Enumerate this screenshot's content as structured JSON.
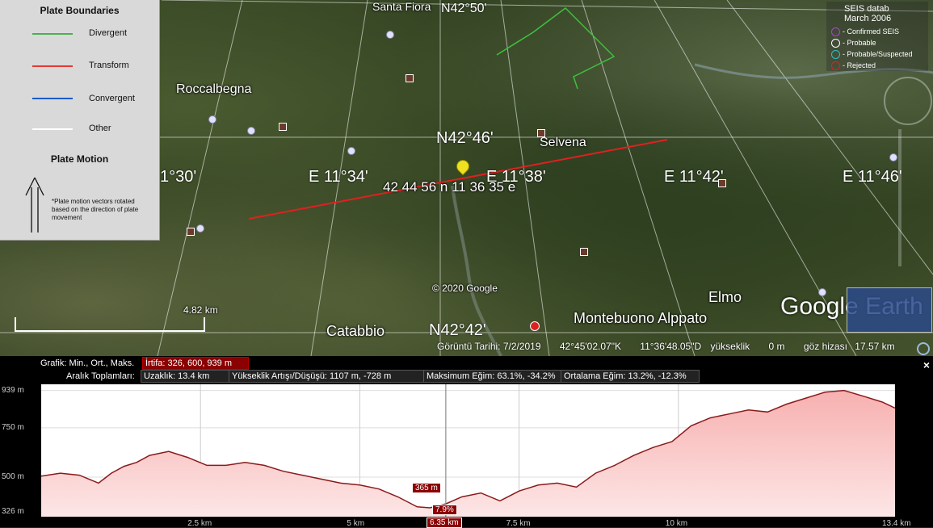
{
  "legend": {
    "title": "Plate Boundaries",
    "items": [
      {
        "label": "Divergent",
        "color": "#4caf50"
      },
      {
        "label": "Transform",
        "color": "#e53935"
      },
      {
        "label": "Convergent",
        "color": "#1e5ac8"
      },
      {
        "label": "Other",
        "color": "#ffffff"
      }
    ],
    "motion_title": "Plate Motion",
    "motion_note": "*Plate motion vectors rotated based on the direction of plate movement"
  },
  "seis": {
    "title": "SEIS datab",
    "subtitle": "March 2006",
    "items": [
      {
        "label": "- Confirmed SEIS",
        "color": "#b040d0"
      },
      {
        "label": "- Probable",
        "color": "#ffffff"
      },
      {
        "label": "- Probable/Suspected",
        "color": "#30c0c0"
      },
      {
        "label": "- Rejected",
        "color": "#e02020"
      }
    ]
  },
  "map": {
    "coords": {
      "n4250": "N42°50'",
      "n4246": "N42°46'",
      "n4242": "N42°42'",
      "e1130": "1°30'",
      "e1134": "E 11°34'",
      "e1138": "E 11°38'",
      "e1142": "E 11°42'",
      "e1146": "E 11°46'"
    },
    "places": {
      "santa_fiora": "Santa Fiora",
      "roccalbegna": "Roccalbegna",
      "selvena": "Selvena",
      "elmo": "Elmo",
      "catabbio": "Catabbio",
      "montebuono": "Montebuono Alppato"
    },
    "pin_label": "42 44 56 n 11 36 35 e",
    "copyright": "© 2020 Google",
    "brand": "Google Earth",
    "scale": "4.82 km",
    "status": {
      "date": "Görüntü Tarihi: 7/2/2019",
      "lat": "42°45'02.07\"K",
      "lon": "11°36'48.05\"D",
      "elev_label": "yükseklik",
      "elev": "0 m",
      "eye_label": "göz hizası",
      "eye": "17.57 km"
    }
  },
  "profile": {
    "row1_label": "Grafik: Min., Ort., Maks.",
    "row1_value": "İrtifa: 326, 600, 939 m",
    "row2_label": "Aralık Toplamları:",
    "distance": "Uzaklık: 13.4 km",
    "gain": "Yükseklik Artışı/Düşüşü: 1107 m, -728 m",
    "max_slope": "Maksimum Eğim: 63.1%, -34.2%",
    "avg_slope": "Ortalama Eğim: 13.2%, -12.3%",
    "cursor_elev": "365 m",
    "cursor_slope": "7.9%",
    "cursor_x": "6.35 km",
    "close": "×"
  },
  "chart_data": {
    "type": "area",
    "title": "",
    "xlabel": "",
    "ylabel": "",
    "ylim": [
      300,
      970
    ],
    "xlim": [
      0,
      13.4
    ],
    "yticks": [
      "326 m",
      "500 m",
      "750 m",
      "939 m"
    ],
    "xticks": [
      "2.5 km",
      "5 km",
      "7.5 km",
      "10 km",
      "13.4 km"
    ],
    "x": [
      0,
      0.3,
      0.6,
      0.9,
      1.1,
      1.3,
      1.5,
      1.7,
      2.0,
      2.3,
      2.6,
      2.9,
      3.2,
      3.5,
      3.8,
      4.1,
      4.4,
      4.7,
      5.0,
      5.3,
      5.6,
      5.9,
      6.1,
      6.35,
      6.6,
      6.9,
      7.2,
      7.5,
      7.8,
      8.1,
      8.4,
      8.7,
      9.0,
      9.3,
      9.6,
      9.9,
      10.2,
      10.5,
      10.8,
      11.1,
      11.4,
      11.7,
      12.0,
      12.3,
      12.6,
      12.9,
      13.2,
      13.4
    ],
    "values": [
      505,
      520,
      510,
      470,
      520,
      555,
      575,
      610,
      630,
      600,
      560,
      560,
      575,
      560,
      530,
      510,
      490,
      470,
      460,
      440,
      400,
      350,
      345,
      365,
      400,
      420,
      380,
      430,
      460,
      470,
      450,
      520,
      560,
      610,
      650,
      680,
      760,
      800,
      820,
      840,
      830,
      870,
      900,
      930,
      939,
      910,
      880,
      850
    ]
  }
}
